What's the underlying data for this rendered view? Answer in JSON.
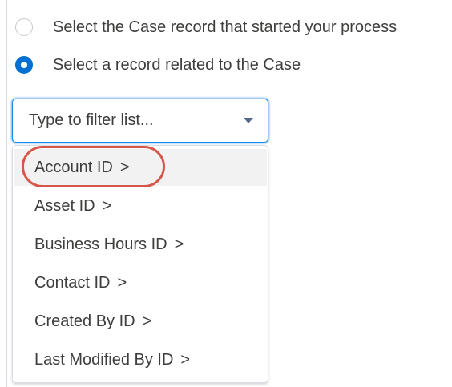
{
  "radio_options": [
    {
      "label": "Select the Case record that started your process",
      "checked": false
    },
    {
      "label": "Select a record related to the Case",
      "checked": true
    }
  ],
  "filter": {
    "placeholder": "Type to filter list...",
    "value": ""
  },
  "list": {
    "chevron": ">",
    "items": [
      {
        "label": "Account ID"
      },
      {
        "label": "Asset ID"
      },
      {
        "label": "Business Hours ID"
      },
      {
        "label": "Contact ID"
      },
      {
        "label": "Created By ID"
      },
      {
        "label": "Last Modified By ID"
      }
    ]
  },
  "colors": {
    "radio_selected": "#0070d2",
    "focus_border": "#1589ee",
    "annotation": "#d6574a",
    "hover_background": "#f3f2f2"
  }
}
